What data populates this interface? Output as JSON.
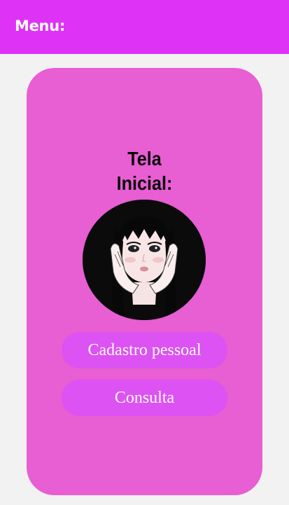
{
  "header": {
    "title": "Menu:"
  },
  "main": {
    "title_line1": "Tela",
    "title_line2": "Inicial:",
    "avatar_icon": "girl-portrait-illustration",
    "buttons": [
      {
        "label": "Cadastro pessoal"
      },
      {
        "label": "Consulta"
      }
    ]
  },
  "colors": {
    "header_bg": "#de33f6",
    "page_bg": "#f2f2f2",
    "card_bg": "#e85ed3",
    "button_bg": "#dd52f2",
    "button_text": "#ffffff"
  }
}
